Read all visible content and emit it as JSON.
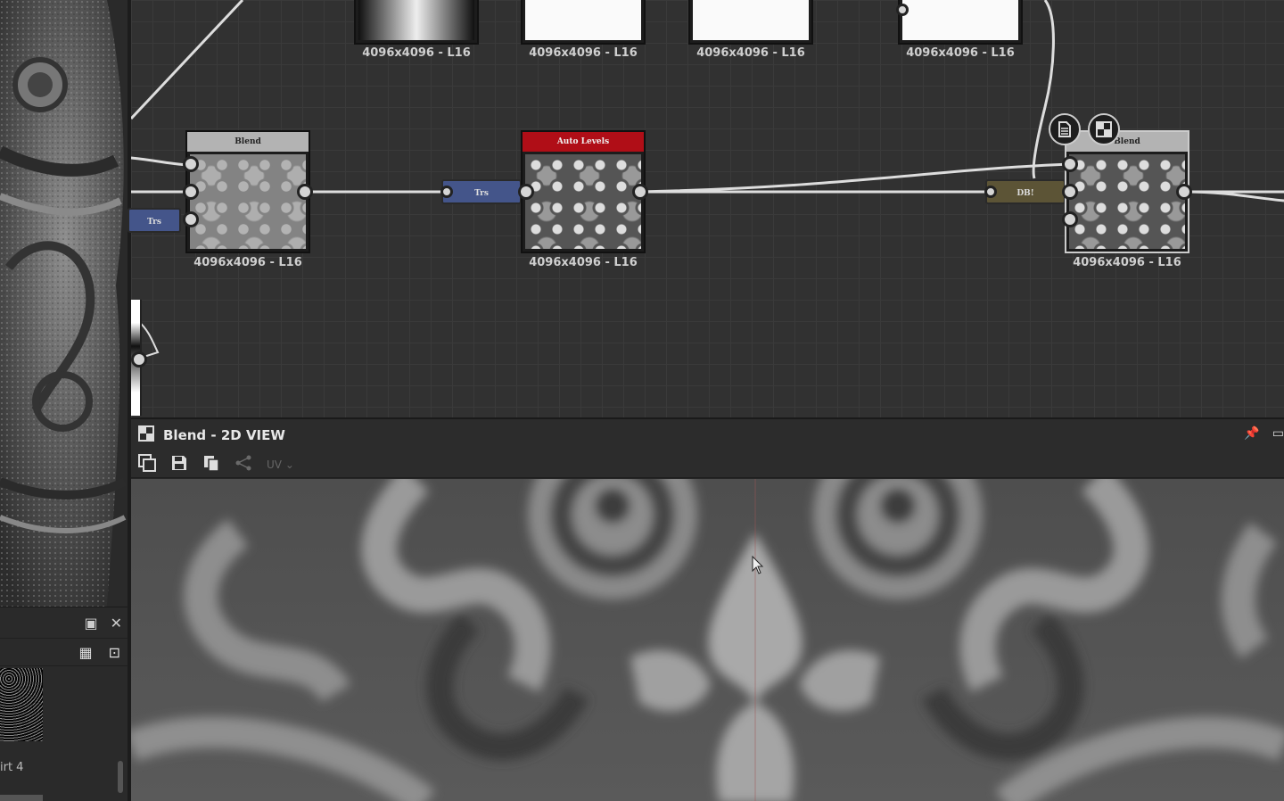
{
  "graph": {
    "top_nodes": [
      {
        "caption": "4096x4096 - L16"
      },
      {
        "caption": "4096x4096 - L16"
      },
      {
        "caption": "4096x4096 - L16"
      },
      {
        "caption": "4096x4096 - L16"
      }
    ],
    "blend_left": {
      "title": "Blend",
      "caption": "4096x4096 - L16"
    },
    "auto_levels": {
      "title": "Auto Levels",
      "caption": "4096x4096 - L16"
    },
    "blend_right": {
      "title": "Blend",
      "caption": "4096x4096 - L16"
    },
    "pills": {
      "trs_left": "Trs",
      "trs_mid": "Trs",
      "dot": "DB!"
    }
  },
  "view2d": {
    "title": "Blend - 2D VIEW",
    "uv_label": "UV"
  },
  "library": {
    "item_label": "irt 4"
  },
  "colors": {
    "node_title_red": "#b00e17",
    "pill_blue": "#44558a",
    "pill_olive": "#5c5436"
  }
}
